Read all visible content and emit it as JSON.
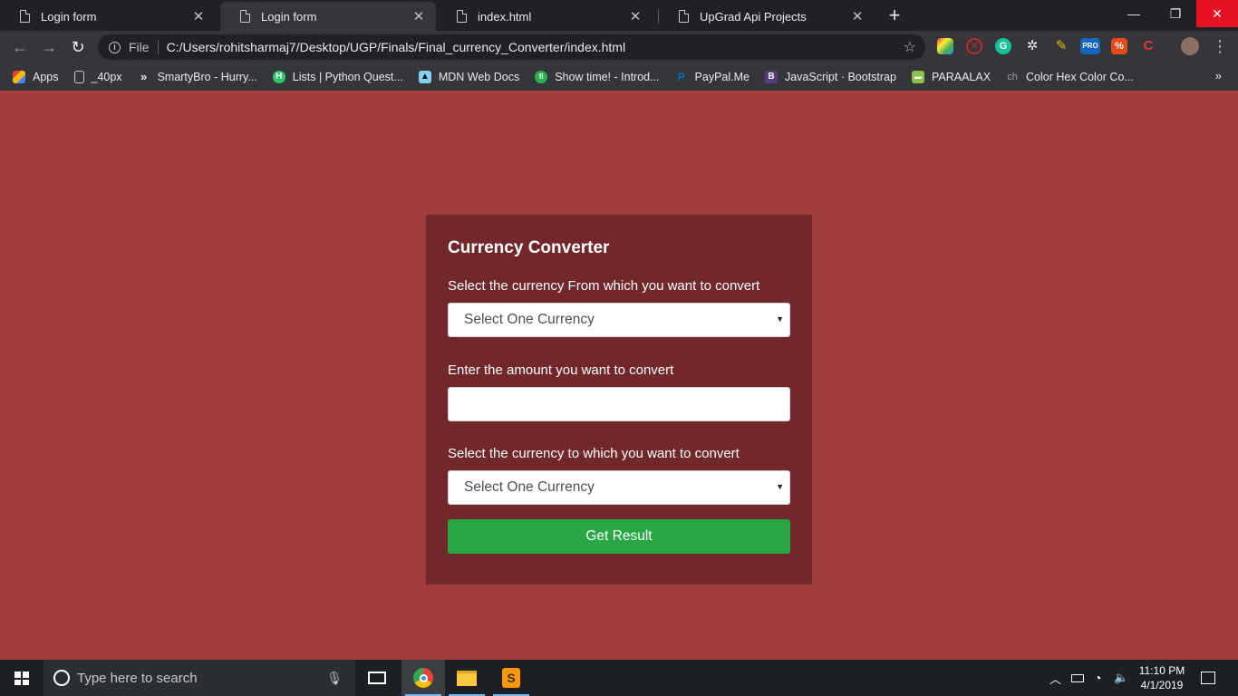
{
  "browser": {
    "tabs": [
      {
        "title": "Login form",
        "active": false
      },
      {
        "title": "Login form",
        "active": true
      },
      {
        "title": "index.html",
        "active": false
      },
      {
        "title": "UpGrad Api Projects",
        "active": false
      }
    ],
    "omnibox": {
      "scheme": "File",
      "url": "C:/Users/rohitsharmaj7/Desktop/UGP/Finals/Final_currency_Converter/index.html"
    },
    "bookmarks": [
      {
        "label": "Apps",
        "icon": "apps-grid-icon"
      },
      {
        "label": "_40px",
        "icon": "page-icon"
      },
      {
        "label": "SmartyBro - Hurry...",
        "icon": "chevrons-icon"
      },
      {
        "label": "Lists | Python Quest...",
        "icon": "hackerrank-icon"
      },
      {
        "label": "MDN Web Docs",
        "icon": "mdn-icon"
      },
      {
        "label": "Show time! - Introd...",
        "icon": "fi-icon"
      },
      {
        "label": "PayPal.Me",
        "icon": "paypal-icon"
      },
      {
        "label": "JavaScript · Bootstrap",
        "icon": "bootstrap-icon"
      },
      {
        "label": "PARAALAX",
        "icon": "parallax-icon"
      },
      {
        "label": "Color Hex Color Co...",
        "icon": "colorhex-icon"
      }
    ],
    "bookmarks_more": "»",
    "extensions": [
      {
        "name": "colorpick-icon",
        "color": "#e91e63",
        "glyph": "◆"
      },
      {
        "name": "adblock-icon",
        "color": "#c62828",
        "glyph": "⊘"
      },
      {
        "name": "grammarly-icon",
        "color": "#15c39a",
        "glyph": "G"
      },
      {
        "name": "settings-gear-icon",
        "color": "#5f6368",
        "glyph": "✲"
      },
      {
        "name": "pencil-icon",
        "color": "#f2b705",
        "glyph": "✎"
      },
      {
        "name": "pro-icon",
        "color": "#1565c0",
        "glyph": "PRO"
      },
      {
        "name": "percent-icon",
        "color": "#e64a19",
        "glyph": "%"
      },
      {
        "name": "codecademy-icon",
        "color": "#e53935",
        "glyph": "C"
      }
    ]
  },
  "converter": {
    "title": "Currency Converter",
    "from_label": "Select the currency From which you want to convert",
    "from_selected": "Select One Currency",
    "amount_label": "Enter the amount you want to convert",
    "amount_value": "",
    "to_label": "Select the currency to which you want to convert",
    "to_selected": "Select One Currency",
    "submit_label": "Get Result"
  },
  "taskbar": {
    "search_placeholder": "Type here to search",
    "time": "11:10 PM",
    "date": "4/1/2019"
  },
  "colors": {
    "page_bg": "#a23c3d",
    "card_bg": "#72282a",
    "button": "#28a745"
  }
}
